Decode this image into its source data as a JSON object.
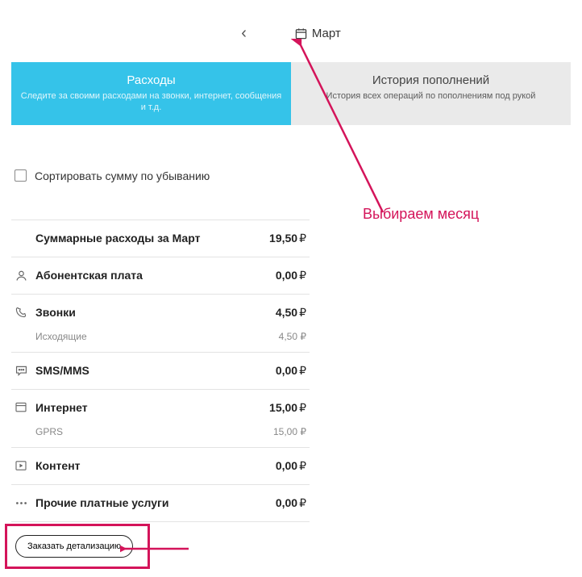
{
  "month": "Март",
  "tabs": {
    "expenses": {
      "title": "Расходы",
      "sub": "Следите за своими расходами на звонки, интернет, сообщения и т.д."
    },
    "history": {
      "title": "История пополнений",
      "sub": "История всех операций по пополнениям под рукой"
    }
  },
  "sort_label": "Сортировать сумму по убыванию",
  "summary": {
    "label": "Суммарные расходы за Март",
    "amount": "19,50"
  },
  "items": [
    {
      "label": "Абонентская плата",
      "amount": "0,00"
    },
    {
      "label": "Звонки",
      "amount": "4,50",
      "sub_label": "Исходящие",
      "sub_amount": "4,50"
    },
    {
      "label": "SMS/MMS",
      "amount": "0,00"
    },
    {
      "label": "Интернет",
      "amount": "15,00",
      "sub_label": "GPRS",
      "sub_amount": "15,00"
    },
    {
      "label": "Контент",
      "amount": "0,00"
    },
    {
      "label": "Прочие платные услуги",
      "amount": "0,00"
    }
  ],
  "currency": "₽",
  "order_button": "Заказать детализацию",
  "annotation": "Выбираем месяц"
}
